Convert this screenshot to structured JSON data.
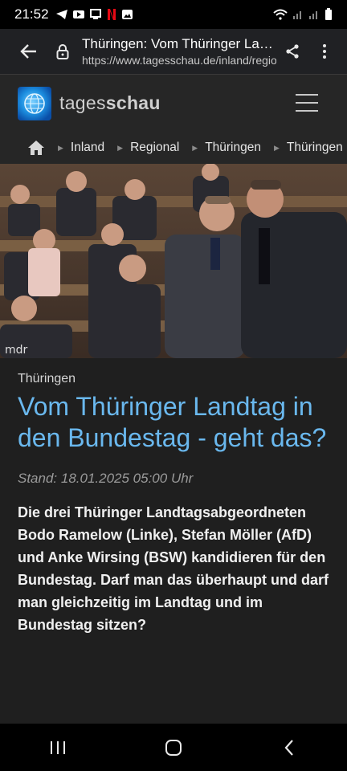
{
  "status": {
    "time": "21:52",
    "icons": [
      "telegram-icon",
      "youtube-tv-icon",
      "cast-icon",
      "netflix-icon",
      "gallery-icon"
    ],
    "right_icons": [
      "wifi-icon",
      "signal-icon",
      "signal-icon",
      "battery-icon"
    ]
  },
  "browser": {
    "page_title": "Thüringen: Vom Thüringer Landtag in den Bundestag - geht das?",
    "url": "https://www.tagesschau.de/inland/regional/thueringen"
  },
  "site": {
    "name_light": "tages",
    "name_bold": "schau"
  },
  "breadcrumb": [
    "Inland",
    "Regional",
    "Thüringen",
    "Thüringen"
  ],
  "hero": {
    "watermark": "mdr"
  },
  "article": {
    "kicker": "Thüringen",
    "headline": "Vom Thüringer Landtag in den Bundestag - geht das?",
    "dateline": "Stand: 18.01.2025 05:00 Uhr",
    "lead": "Die drei Thüringer Landtagsabgeordneten Bodo Ramelow (Linke), Stefan Möller (AfD) und Anke Wirsing (BSW) kandidieren für den Bundestag. Darf man das überhaupt und darf man gleichzeitig im Landtag und im Bundestag sitzen?"
  },
  "colors": {
    "headline": "#6ab8ee",
    "background": "#1f1f1f",
    "header": "#262626"
  }
}
